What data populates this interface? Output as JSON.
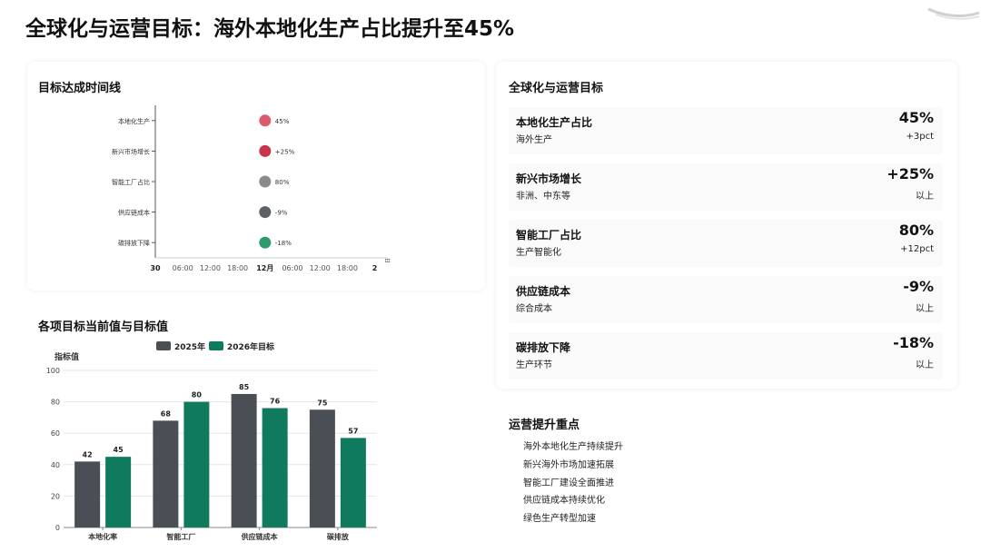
{
  "page": {
    "title": "全球化与运营目标：海外本地化生产占比提升至45%"
  },
  "colors": {
    "dark_gray": "#4a4f55",
    "green": "#0f7a5e",
    "red_dot": "#dd5a6a",
    "crimson_dot": "#c8364d",
    "gray_dot": "#8a8a8a",
    "dark_dot": "#5d6166",
    "green_dot": "#2e9a6f"
  },
  "timeline": {
    "title": "目标达成时间线",
    "axis_ticks": [
      "30",
      "06:00",
      "12:00",
      "18:00",
      "12月",
      "06:00",
      "12:00",
      "18:00",
      "2"
    ],
    "end_marker": "日"
  },
  "goals_panel": {
    "title": "全球化与运营目标",
    "items": [
      {
        "name": "本地化生产占比",
        "sub": "海外生产",
        "value": "45%",
        "delta": "+3pct"
      },
      {
        "name": "新兴市场增长",
        "sub": "非洲、中东等",
        "value": "+25%",
        "delta": "以上"
      },
      {
        "name": "智能工厂占比",
        "sub": "生产智能化",
        "value": "80%",
        "delta": "+12pct"
      },
      {
        "name": "供应链成本",
        "sub": "综合成本",
        "value": "-9%",
        "delta": "以上"
      },
      {
        "name": "碳排放下降",
        "sub": "生产环节",
        "value": "-18%",
        "delta": "以上"
      }
    ]
  },
  "focus": {
    "title": "运营提升重点",
    "items": [
      "海外本地化生产持续提升",
      "新兴海外市场加速拓展",
      "智能工厂建设全面推进",
      "供应链成本持续优化",
      "绿色生产转型加速"
    ]
  },
  "chart_data": [
    {
      "type": "scatter",
      "title": "目标达成时间线",
      "categories": [
        "本地化生产",
        "新兴市场增长",
        "智能工厂占比",
        "供应链成本",
        "碳排放下降"
      ],
      "labels": [
        "45%",
        "+25%",
        "80%",
        "-9%",
        "-18%"
      ],
      "x_ticks": [
        "30",
        "06:00",
        "12:00",
        "18:00",
        "12月",
        "06:00",
        "12:00",
        "18:00",
        "2"
      ],
      "x_position_tick": "12月",
      "grid": false
    },
    {
      "type": "bar",
      "title": "各项目标当前值与目标值",
      "categories": [
        "本地化率",
        "智能工厂",
        "供应链成本",
        "碳排放"
      ],
      "series": [
        {
          "name": "2025年",
          "values": [
            42,
            68,
            85,
            75
          ]
        },
        {
          "name": "2026年目标",
          "values": [
            45,
            80,
            76,
            57
          ]
        }
      ],
      "ylabel": "指标值",
      "ylim": [
        0,
        100
      ],
      "y_ticks": [
        0,
        20,
        40,
        60,
        80,
        100
      ],
      "legend": "top-center",
      "grid": true
    }
  ]
}
